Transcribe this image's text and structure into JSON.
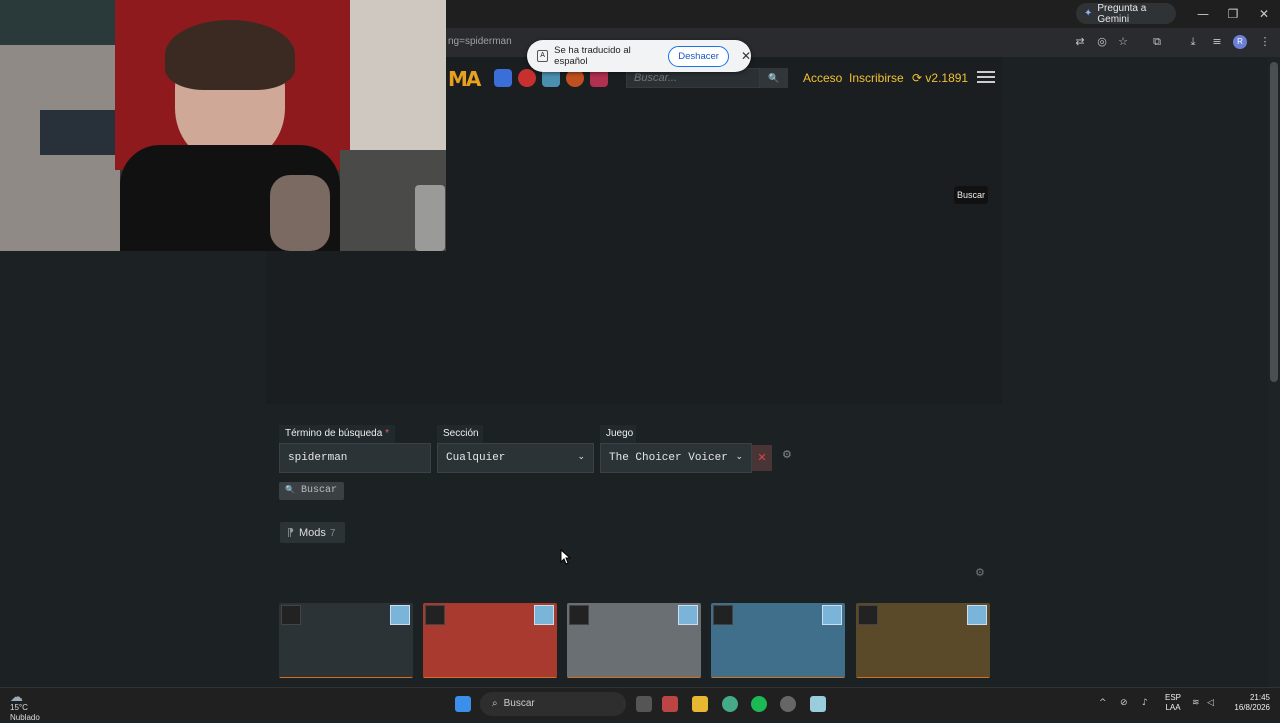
{
  "browser": {
    "gemini_label": "Pregunta a Gemini",
    "url_text": "ng=spiderman",
    "window_controls": [
      "—",
      "❐",
      "✕"
    ],
    "profile_initial": "R"
  },
  "translate_bar": {
    "message": "Se ha traducido al español",
    "undo_label": "Deshacer",
    "close_label": "✕"
  },
  "site": {
    "logo_text": "MA",
    "search_placeholder": "Buscar...",
    "search_button_icon": "🔍",
    "login_label": "Acceso",
    "signup_label": "Inscribirse",
    "version": "v2.1891",
    "version_icon": "⟳"
  },
  "overlay_buscar": "Buscar",
  "form": {
    "term_label": "Término de búsqueda",
    "term_required": "*",
    "term_value": "spiderman",
    "section_label": "Sección",
    "section_value": "Cualquier",
    "game_label": "Juego",
    "game_value": "The Choicer Voicer",
    "clear_icon": "✕",
    "settings_icon": "⚙",
    "search_button_label": "Buscar",
    "search_button_icon": "🔍"
  },
  "results": {
    "tab_icon": "⁋",
    "tab_label": "Mods",
    "tab_count": "7",
    "settings_icon": "⚙",
    "colors": {
      "thumb1": "#2b3336",
      "thumb2": "#a83a30",
      "thumb3": "#6a6f74",
      "thumb4": "#3f6f8a",
      "thumb5": "#5b4a2a"
    }
  },
  "taskbar": {
    "temperature": "15°C",
    "weather": "Nublado",
    "search_label": "Buscar",
    "lang_top": "ESP",
    "lang_bottom": "LAA",
    "time": "21:45",
    "date": "16/8/2026"
  }
}
